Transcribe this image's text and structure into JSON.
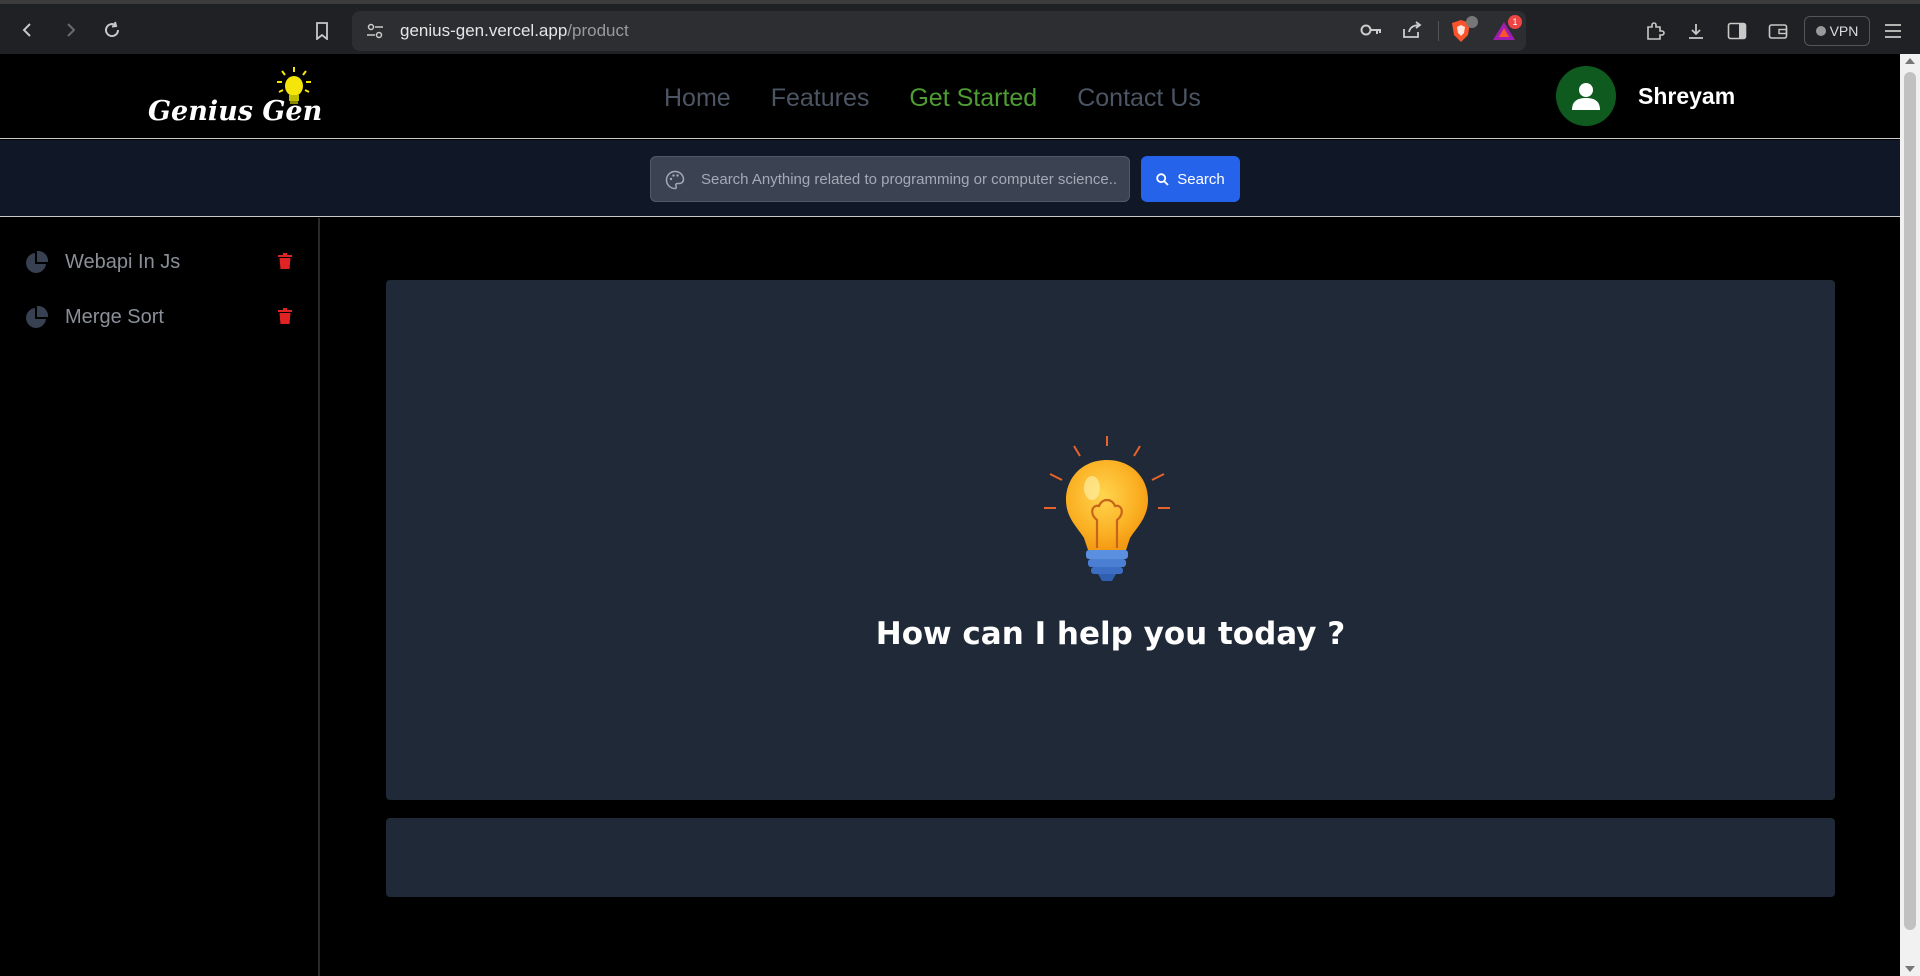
{
  "browser": {
    "url_host": "genius-gen.vercel.app",
    "url_path": "/product",
    "vpn_label": "VPN",
    "brave_badge": "",
    "alert_badge": "1"
  },
  "nav": {
    "logo_text": "Genius Gen",
    "items": [
      {
        "label": "Home",
        "active": false
      },
      {
        "label": "Features",
        "active": false
      },
      {
        "label": "Get Started",
        "active": true
      },
      {
        "label": "Contact Us",
        "active": false
      }
    ],
    "user_name": "Shreyam"
  },
  "search": {
    "placeholder": "Search Anything related to programming or computer science..",
    "button_label": "Search"
  },
  "sidebar": {
    "items": [
      {
        "label": "Webapi In Js"
      },
      {
        "label": "Merge Sort"
      }
    ]
  },
  "main": {
    "greeting": "How can I help you today ?"
  },
  "colors": {
    "accent_green": "#4e9d34",
    "search_blue": "#2563eb",
    "card_bg": "#1f2937",
    "trash_red": "#e02424"
  }
}
